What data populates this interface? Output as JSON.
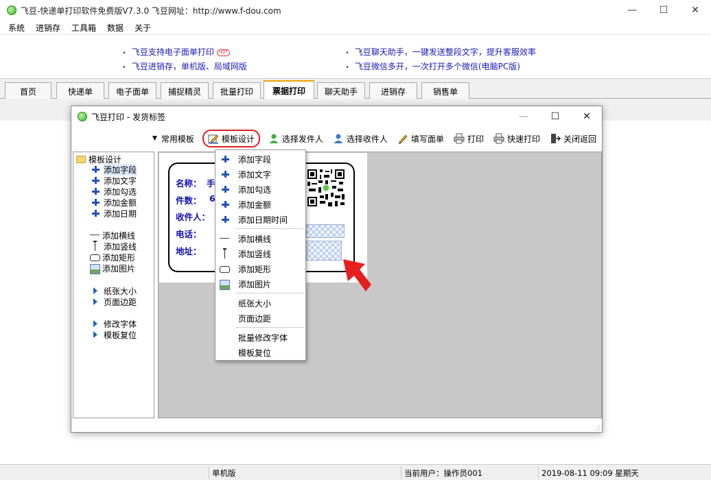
{
  "window": {
    "title": "飞豆-快递单打印软件免费版V7.3.0   飞豆网址：http://www.f-dou.com",
    "minimize": "—",
    "maximize": "☐",
    "close": "✕"
  },
  "menu": [
    "系统",
    "进销存",
    "工具箱",
    "数据",
    "关于"
  ],
  "news": {
    "left": [
      "飞豆支持电子面单打印",
      "飞豆进销存，单机版、局域网版"
    ],
    "hot_badge": "HOT",
    "right": [
      "飞豆聊天助手，一键发送整段文字，提升客服效率",
      "飞豆微信多开，一次打开多个微信(电脑PC版)"
    ]
  },
  "tabs": [
    "首页",
    "快递单",
    "电子面单",
    "捕捉精灵",
    "批量打印",
    "票据打印",
    "聊天助手",
    "进销存",
    "销售单"
  ],
  "active_tab": "票据打印",
  "dialog": {
    "title": "飞豆打印 - 发货标签",
    "minimize": "—",
    "maximize": "☐",
    "close": "✕",
    "toolbar": {
      "common_template": "常用模板",
      "template_design": "模板设计",
      "select_sender": "选择发件人",
      "select_receiver": "选择收件人",
      "fill_form": "填写面单",
      "print": "打印",
      "quick_print": "快速打印",
      "close_return": "关闭返回"
    },
    "tree": {
      "root": "模板设计",
      "items": [
        "添加字段",
        "添加文字",
        "添加勾选",
        "添加金额",
        "添加日期",
        "添加横线",
        "添加竖线",
        "添加矩形",
        "添加图片",
        "纸张大小",
        "页面边距",
        "修改字体",
        "模板复位"
      ]
    },
    "label": {
      "name_label": "名称：",
      "name_value": "手",
      "count_label": "件数：",
      "count_value": "6",
      "receiver_label": "收件人：",
      "phone_label": "电话：",
      "address_label": "地址："
    },
    "dropdown": [
      "添加字段",
      "添加文字",
      "添加勾选",
      "添加金额",
      "添加日期时间",
      "添加横线",
      "添加竖线",
      "添加矩形",
      "添加图片",
      "纸张大小",
      "页面边距",
      "批量修改字体",
      "模板复位"
    ]
  },
  "status": {
    "mode": "单机版",
    "user": "当前用户：操作员001",
    "datetime": "2019-08-11 09:09 星期天"
  },
  "colors": {
    "link_blue": "#1a1ab8",
    "field_blue": "#1010b0",
    "highlight_red": "#e02020",
    "tab_active_accent": "#f0a000"
  }
}
